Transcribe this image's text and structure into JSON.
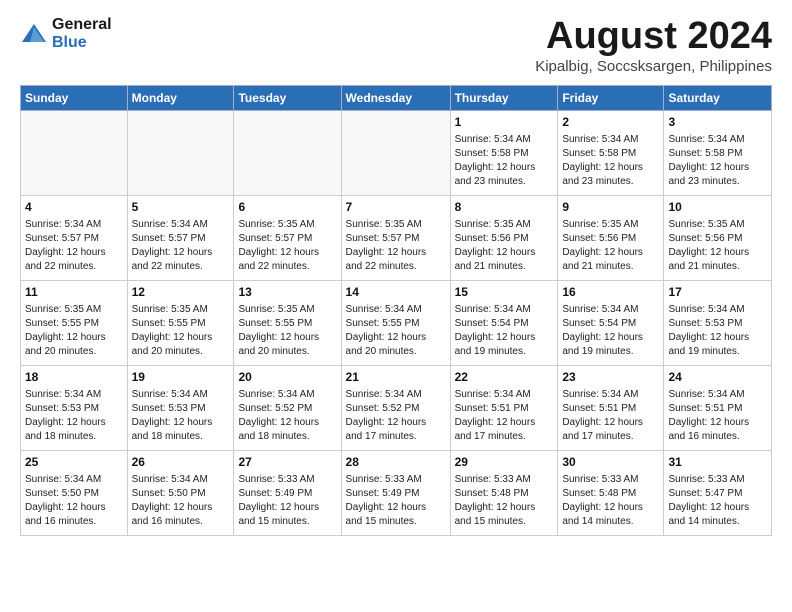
{
  "header": {
    "logo_general": "General",
    "logo_blue": "Blue",
    "month_title": "August 2024",
    "location": "Kipalbig, Soccsksargen, Philippines"
  },
  "weekdays": [
    "Sunday",
    "Monday",
    "Tuesday",
    "Wednesday",
    "Thursday",
    "Friday",
    "Saturday"
  ],
  "weeks": [
    [
      {
        "day": "",
        "empty": true
      },
      {
        "day": "",
        "empty": true
      },
      {
        "day": "",
        "empty": true
      },
      {
        "day": "",
        "empty": true
      },
      {
        "day": "1",
        "sunrise": "5:34 AM",
        "sunset": "5:58 PM",
        "daylight": "12 hours and 23 minutes."
      },
      {
        "day": "2",
        "sunrise": "5:34 AM",
        "sunset": "5:58 PM",
        "daylight": "12 hours and 23 minutes."
      },
      {
        "day": "3",
        "sunrise": "5:34 AM",
        "sunset": "5:58 PM",
        "daylight": "12 hours and 23 minutes."
      }
    ],
    [
      {
        "day": "4",
        "sunrise": "5:34 AM",
        "sunset": "5:57 PM",
        "daylight": "12 hours and 22 minutes."
      },
      {
        "day": "5",
        "sunrise": "5:34 AM",
        "sunset": "5:57 PM",
        "daylight": "12 hours and 22 minutes."
      },
      {
        "day": "6",
        "sunrise": "5:35 AM",
        "sunset": "5:57 PM",
        "daylight": "12 hours and 22 minutes."
      },
      {
        "day": "7",
        "sunrise": "5:35 AM",
        "sunset": "5:57 PM",
        "daylight": "12 hours and 22 minutes."
      },
      {
        "day": "8",
        "sunrise": "5:35 AM",
        "sunset": "5:56 PM",
        "daylight": "12 hours and 21 minutes."
      },
      {
        "day": "9",
        "sunrise": "5:35 AM",
        "sunset": "5:56 PM",
        "daylight": "12 hours and 21 minutes."
      },
      {
        "day": "10",
        "sunrise": "5:35 AM",
        "sunset": "5:56 PM",
        "daylight": "12 hours and 21 minutes."
      }
    ],
    [
      {
        "day": "11",
        "sunrise": "5:35 AM",
        "sunset": "5:55 PM",
        "daylight": "12 hours and 20 minutes."
      },
      {
        "day": "12",
        "sunrise": "5:35 AM",
        "sunset": "5:55 PM",
        "daylight": "12 hours and 20 minutes."
      },
      {
        "day": "13",
        "sunrise": "5:35 AM",
        "sunset": "5:55 PM",
        "daylight": "12 hours and 20 minutes."
      },
      {
        "day": "14",
        "sunrise": "5:34 AM",
        "sunset": "5:55 PM",
        "daylight": "12 hours and 20 minutes."
      },
      {
        "day": "15",
        "sunrise": "5:34 AM",
        "sunset": "5:54 PM",
        "daylight": "12 hours and 19 minutes."
      },
      {
        "day": "16",
        "sunrise": "5:34 AM",
        "sunset": "5:54 PM",
        "daylight": "12 hours and 19 minutes."
      },
      {
        "day": "17",
        "sunrise": "5:34 AM",
        "sunset": "5:53 PM",
        "daylight": "12 hours and 19 minutes."
      }
    ],
    [
      {
        "day": "18",
        "sunrise": "5:34 AM",
        "sunset": "5:53 PM",
        "daylight": "12 hours and 18 minutes."
      },
      {
        "day": "19",
        "sunrise": "5:34 AM",
        "sunset": "5:53 PM",
        "daylight": "12 hours and 18 minutes."
      },
      {
        "day": "20",
        "sunrise": "5:34 AM",
        "sunset": "5:52 PM",
        "daylight": "12 hours and 18 minutes."
      },
      {
        "day": "21",
        "sunrise": "5:34 AM",
        "sunset": "5:52 PM",
        "daylight": "12 hours and 17 minutes."
      },
      {
        "day": "22",
        "sunrise": "5:34 AM",
        "sunset": "5:51 PM",
        "daylight": "12 hours and 17 minutes."
      },
      {
        "day": "23",
        "sunrise": "5:34 AM",
        "sunset": "5:51 PM",
        "daylight": "12 hours and 17 minutes."
      },
      {
        "day": "24",
        "sunrise": "5:34 AM",
        "sunset": "5:51 PM",
        "daylight": "12 hours and 16 minutes."
      }
    ],
    [
      {
        "day": "25",
        "sunrise": "5:34 AM",
        "sunset": "5:50 PM",
        "daylight": "12 hours and 16 minutes."
      },
      {
        "day": "26",
        "sunrise": "5:34 AM",
        "sunset": "5:50 PM",
        "daylight": "12 hours and 16 minutes."
      },
      {
        "day": "27",
        "sunrise": "5:33 AM",
        "sunset": "5:49 PM",
        "daylight": "12 hours and 15 minutes."
      },
      {
        "day": "28",
        "sunrise": "5:33 AM",
        "sunset": "5:49 PM",
        "daylight": "12 hours and 15 minutes."
      },
      {
        "day": "29",
        "sunrise": "5:33 AM",
        "sunset": "5:48 PM",
        "daylight": "12 hours and 15 minutes."
      },
      {
        "day": "30",
        "sunrise": "5:33 AM",
        "sunset": "5:48 PM",
        "daylight": "12 hours and 14 minutes."
      },
      {
        "day": "31",
        "sunrise": "5:33 AM",
        "sunset": "5:47 PM",
        "daylight": "12 hours and 14 minutes."
      }
    ]
  ]
}
